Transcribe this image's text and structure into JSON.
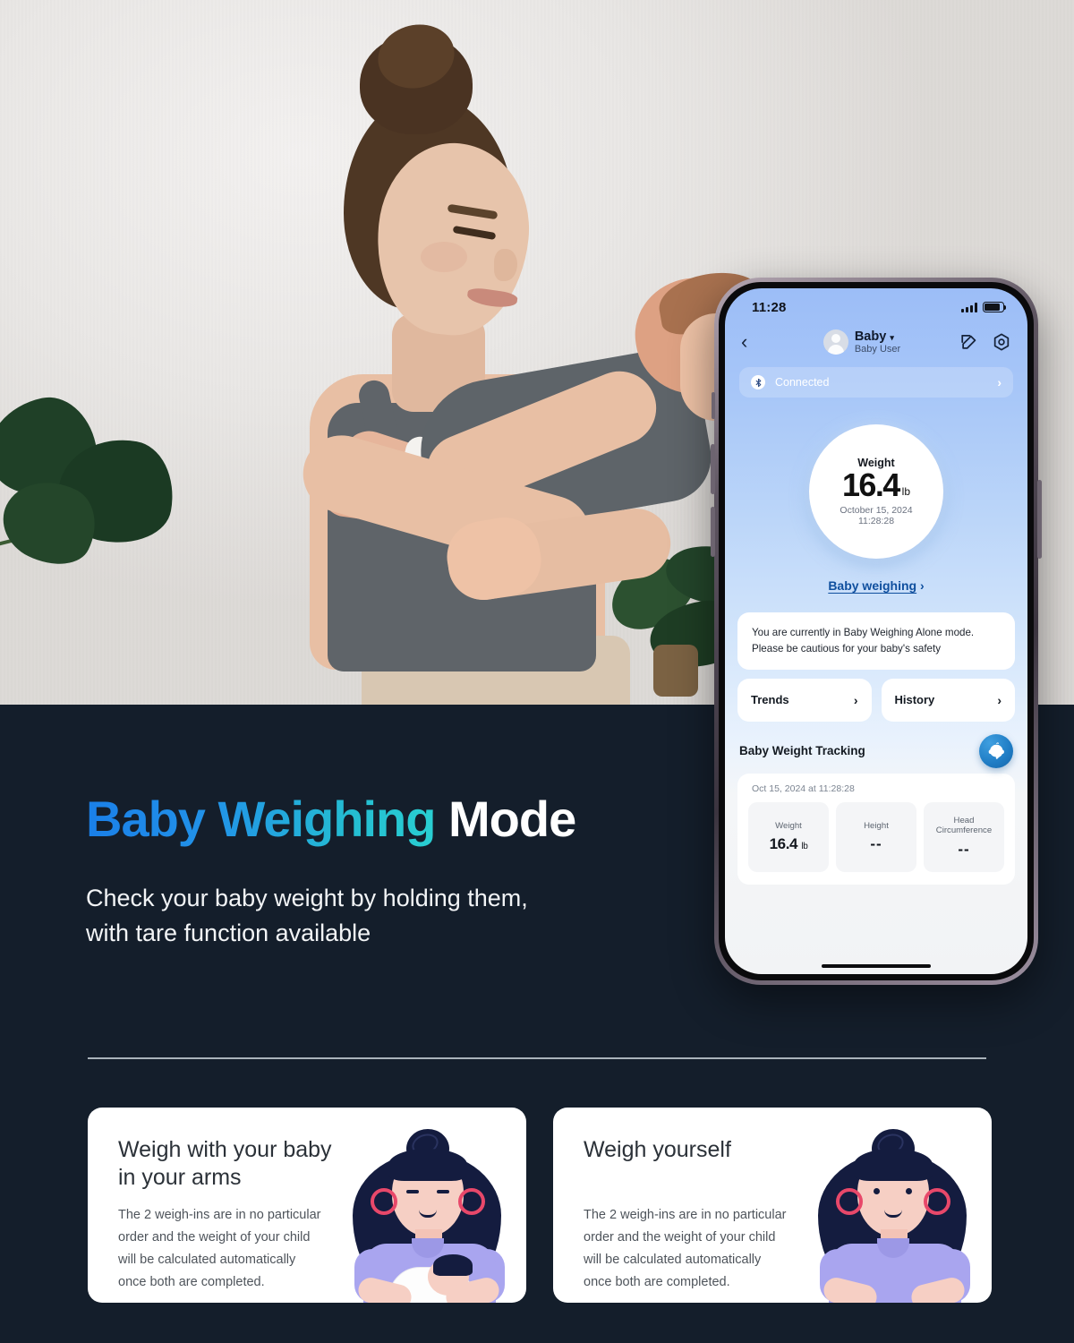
{
  "hero": {
    "alt": "Mother holding newborn baby against light wall with plants"
  },
  "promo": {
    "headline_gradient": "Baby Weighing ",
    "headline_white": "Mode",
    "subheadline_line1": "Check your baby weight by holding them,",
    "subheadline_line2": "with tare function available",
    "accent_start": "#1a7fe8",
    "accent_end": "#2ad2d2",
    "background": "#141E2B"
  },
  "cards": [
    {
      "title_line1": "Weigh with your baby",
      "title_line2": "in your arms",
      "body_line1": "The 2 weigh-ins are in no particular",
      "body_line2": "order and the weight of your child",
      "body_line3": "will be calculated automatically",
      "body_line4": "once both are completed.",
      "art": "mother-holding-baby-illustration"
    },
    {
      "title_line1": "Weigh yourself",
      "title_line2": "",
      "body_line1": "The 2 weigh-ins are in no particular",
      "body_line2": "order and the weight of your child",
      "body_line3": "will be calculated automatically",
      "body_line4": "once both are completed.",
      "art": "woman-standing-illustration"
    }
  ],
  "phone": {
    "status_bar": {
      "time": "11:28",
      "signal_icon": "cellular-bars-icon",
      "battery_icon": "battery-full-icon"
    },
    "nav": {
      "back_icon": "chevron-left-icon",
      "avatar_icon": "user-avatar-icon",
      "title": "Baby",
      "caret": "▾",
      "subtitle": "Baby User",
      "edit_icon": "edit-square-icon",
      "settings_icon": "settings-gear-icon"
    },
    "connection": {
      "icon": "bluetooth-icon",
      "label": "Connected",
      "arrow": "›"
    },
    "dial": {
      "label": "Weight",
      "value": "16.4",
      "unit": "lb",
      "date": "October 15, 2024",
      "time": "11:28:28"
    },
    "mode_link": {
      "label": "Baby weighing",
      "arrow": "›"
    },
    "notice": {
      "line1": "You are currently in Baby Weighing Alone mode.",
      "line2": "Please be cautious for your baby's safety"
    },
    "quick_buttons": [
      {
        "label": "Trends",
        "arrow": "›"
      },
      {
        "label": "History",
        "arrow": "›"
      }
    ],
    "tracking": {
      "title": "Baby Weight Tracking",
      "badge_icon": "baby-face-icon",
      "timestamp": "Oct 15, 2024 at 11:28:28",
      "metrics": [
        {
          "label": "Weight",
          "value": "16.4",
          "unit": "lb"
        },
        {
          "label": "Height",
          "value": "--",
          "unit": ""
        },
        {
          "label_line1": "Head",
          "label_line2": "Circumference",
          "value": "--",
          "unit": ""
        }
      ]
    }
  }
}
